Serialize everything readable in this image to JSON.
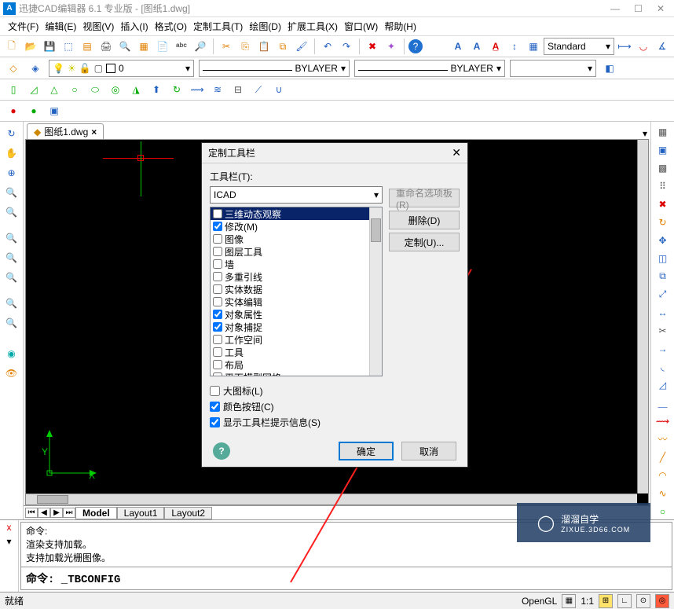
{
  "title": "迅捷CAD编辑器 6.1 专业版  - [图纸1.dwg]",
  "menu": [
    "文件(F)",
    "编辑(E)",
    "视图(V)",
    "插入(I)",
    "格式(O)",
    "定制工具(T)",
    "绘图(D)",
    "扩展工具(X)",
    "窗口(W)",
    "帮助(H)"
  ],
  "toolbar_text": {
    "style_combo": "Standard"
  },
  "layer": {
    "current": "0",
    "linetype": "BYLAYER",
    "lineweight": "BYLAYER"
  },
  "doc_tab": "图纸1.dwg",
  "ucs": {
    "x": "X",
    "y": "Y"
  },
  "dialog": {
    "title": "定制工具栏",
    "label": "工具栏(T):",
    "combo": "ICAD",
    "items": [
      {
        "label": "三维动态观察",
        "checked": false,
        "sel": true
      },
      {
        "label": "修改(M)",
        "checked": true
      },
      {
        "label": "图像",
        "checked": false
      },
      {
        "label": "图层工具",
        "checked": false
      },
      {
        "label": "墙",
        "checked": false
      },
      {
        "label": "多重引线",
        "checked": false
      },
      {
        "label": "实体数据",
        "checked": false
      },
      {
        "label": "实体编辑",
        "checked": false
      },
      {
        "label": "对象属性",
        "checked": true
      },
      {
        "label": "对象捕捉",
        "checked": true
      },
      {
        "label": "工作空间",
        "checked": false
      },
      {
        "label": "工具",
        "checked": false
      },
      {
        "label": "布局",
        "checked": false
      },
      {
        "label": "平面模型网格",
        "checked": false
      }
    ],
    "big_icons": {
      "label": "大图标(L)",
      "checked": false
    },
    "color_btn": {
      "label": "颜色按钮(C)",
      "checked": true
    },
    "show_tip": {
      "label": "显示工具栏提示信息(S)",
      "checked": true
    },
    "rename_btn": "重命名选项板(R)",
    "delete_btn": "删除(D)",
    "custom_btn": "定制(U)...",
    "ok": "确定",
    "cancel": "取消"
  },
  "layout_tabs": {
    "model": "Model",
    "l1": "Layout1",
    "l2": "Layout2"
  },
  "cmd": {
    "history_1": "命令:",
    "history_2": "渲染支持加载。",
    "history_3": "支持加载光栅图像。",
    "history_4": "命令:  _TBCONFIG",
    "input": "命令:  _TBCONFIG"
  },
  "status": {
    "ready": "就绪",
    "opengl": "OpenGL",
    "ratio": "1:1"
  },
  "watermark": {
    "name": "溜溜自学",
    "url": "ZIXUE.3D66.COM"
  }
}
